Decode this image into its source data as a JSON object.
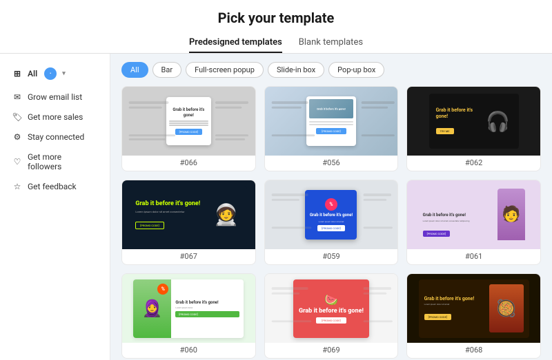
{
  "header": {
    "title": "Pick your template",
    "tabs": [
      {
        "label": "Predesigned templates",
        "active": true
      },
      {
        "label": "Blank templates",
        "active": false
      }
    ]
  },
  "sidebar": {
    "all_label": "All",
    "items": [
      {
        "id": "grow-email",
        "label": "Grow email list",
        "icon": "✉"
      },
      {
        "id": "get-sales",
        "label": "Get more sales",
        "icon": "🏷"
      },
      {
        "id": "stay-connected",
        "label": "Stay connected",
        "icon": "⚙"
      },
      {
        "id": "get-followers",
        "label": "Get more followers",
        "icon": "♡"
      },
      {
        "id": "get-feedback",
        "label": "Get feedback",
        "icon": "☆"
      }
    ]
  },
  "filters": {
    "pills": [
      {
        "label": "All",
        "active": true
      },
      {
        "label": "Bar",
        "active": false
      },
      {
        "label": "Full-screen popup",
        "active": false
      },
      {
        "label": "Slide-in box",
        "active": false
      },
      {
        "label": "Pop-up box",
        "active": false
      }
    ]
  },
  "templates": [
    {
      "id": "066",
      "label": "#066",
      "type": "popup-light"
    },
    {
      "id": "056",
      "label": "#056",
      "type": "popup-photo"
    },
    {
      "id": "062",
      "label": "#062",
      "type": "dark-headphones"
    },
    {
      "id": "067",
      "label": "#067",
      "type": "dark-astronaut"
    },
    {
      "id": "059",
      "label": "#059",
      "type": "blue-popup"
    },
    {
      "id": "061",
      "label": "#061",
      "type": "purple-person"
    },
    {
      "id": "060",
      "label": "#060",
      "type": "green-person"
    },
    {
      "id": "069",
      "label": "#069",
      "type": "coral-watermelon"
    },
    {
      "id": "068",
      "label": "#068",
      "type": "dark-food"
    }
  ]
}
